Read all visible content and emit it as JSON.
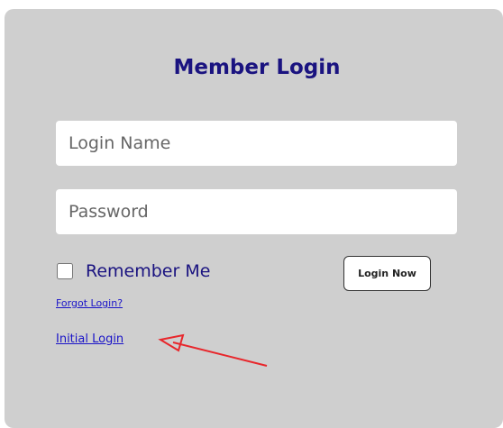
{
  "login_form": {
    "title": "Member Login",
    "login_name_placeholder": "Login Name",
    "password_placeholder": "Password",
    "remember_label": "Remember Me",
    "remember_checked": false,
    "submit_label": "Login Now",
    "forgot_link": "Forgot Login?",
    "initial_link": "Initial Login"
  },
  "colors": {
    "panel": "#cfcfcf",
    "title": "#1a1380",
    "link": "#1a14c8",
    "annotation_arrow": "#e8262b"
  }
}
